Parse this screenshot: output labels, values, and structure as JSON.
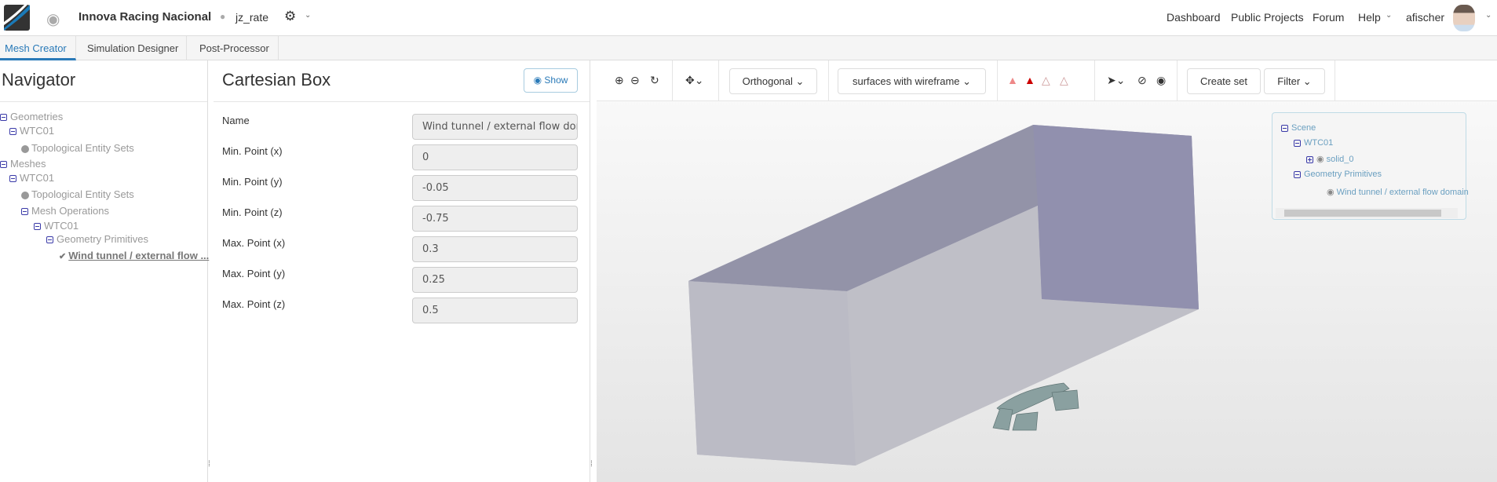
{
  "header": {
    "project_title": "Innova Racing Nacional",
    "owner": "jz_rate",
    "nav": [
      "Dashboard",
      "Public Projects",
      "Forum",
      "Help"
    ],
    "user": "afischer"
  },
  "tabs": [
    "Mesh Creator",
    "Simulation Designer",
    "Post-Processor"
  ],
  "navigator": {
    "title": "Navigator",
    "tree": [
      {
        "label": "Geometries",
        "icon": "minus"
      },
      {
        "label": "WTC01",
        "icon": "minus"
      },
      {
        "label": "Topological Entity Sets",
        "icon": "dot"
      },
      {
        "label": "Meshes",
        "icon": "minus"
      },
      {
        "label": "WTC01",
        "icon": "minus"
      },
      {
        "label": "Topological Entity Sets",
        "icon": "dot"
      },
      {
        "label": "Mesh Operations",
        "icon": "minus"
      },
      {
        "label": "WTC01",
        "icon": "minus"
      },
      {
        "label": "Geometry Primitives",
        "icon": "minus"
      },
      {
        "label": "Wind tunnel / external flow ...",
        "icon": "check-circle"
      }
    ]
  },
  "form": {
    "title": "Cartesian Box",
    "show_label": "Show",
    "fields": [
      {
        "label": "Name",
        "value": "Wind tunnel / external flow domain"
      },
      {
        "label": "Min. Point (x)",
        "value": "0"
      },
      {
        "label": "Min. Point (y)",
        "value": "-0.05"
      },
      {
        "label": "Min. Point (z)",
        "value": "-0.75"
      },
      {
        "label": "Max. Point (x)",
        "value": "0.3"
      },
      {
        "label": "Max. Point (y)",
        "value": "0.25"
      },
      {
        "label": "Max. Point (z)",
        "value": "0.5"
      }
    ]
  },
  "toolbar": {
    "projection": "Orthogonal",
    "render_mode": "surfaces with wireframe",
    "create_set": "Create set",
    "filter": "Filter"
  },
  "scene": {
    "root": "Scene",
    "items": [
      "WTC01",
      "solid_0",
      "Geometry Primitives",
      "Wind tunnel / external flow domain"
    ]
  },
  "colors": {
    "accent": "#2a7ab8",
    "box_top": "#9292aa",
    "box_side": "#bebec6",
    "car": "#8aa0a0"
  }
}
